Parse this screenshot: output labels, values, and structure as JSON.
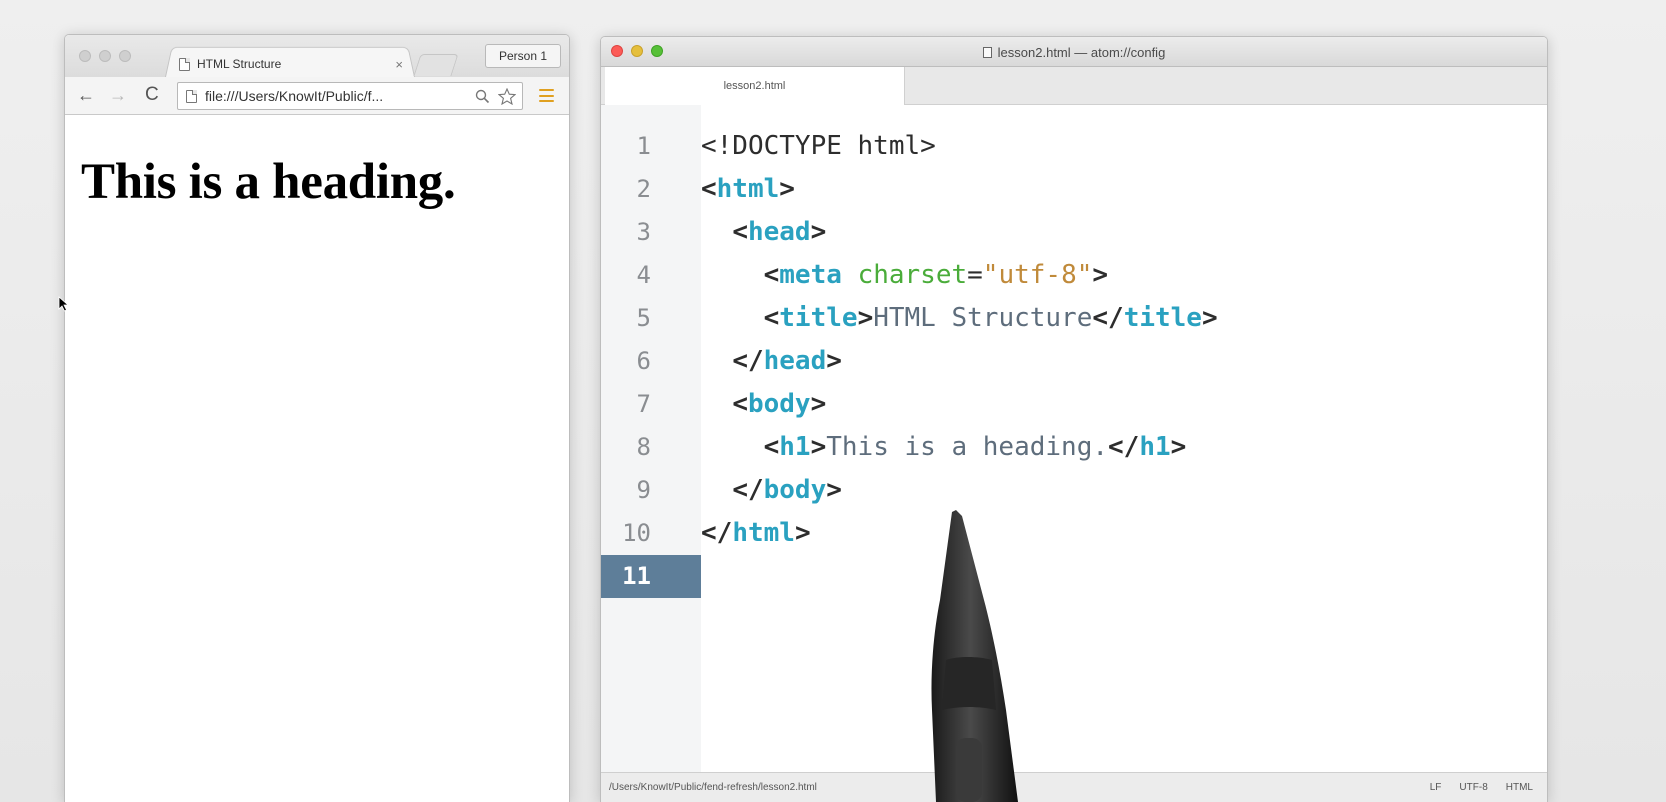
{
  "browser": {
    "tab_title": "HTML Structure",
    "tab_close": "×",
    "profile_button": "Person 1",
    "back": "←",
    "forward": "→",
    "reload": "C",
    "url": "file:///Users/KnowIt/Public/f...",
    "heading": "This is a heading."
  },
  "editor": {
    "window_title": "lesson2.html — atom://config",
    "tab_label": "lesson2.html",
    "line_numbers": [
      "1",
      "2",
      "3",
      "4",
      "5",
      "6",
      "7",
      "8",
      "9",
      "10",
      "11"
    ],
    "active_line": "11",
    "code": {
      "l1": "<!DOCTYPE html>",
      "tag_html": "html",
      "tag_head": "head",
      "tag_meta": "meta",
      "attr_charset": "charset",
      "val_charset": "\"utf-8\"",
      "tag_title": "title",
      "text_title": "HTML Structure",
      "tag_body": "body",
      "tag_h1": "h1",
      "text_h1": "This is a heading."
    },
    "status": {
      "path": "/Users/KnowIt/Public/fend-refresh/lesson2.html",
      "line_ending": "LF",
      "encoding": "UTF-8",
      "grammar": "HTML"
    }
  },
  "colors": {
    "tag": "#2aa1c0",
    "attribute": "#4aac3a",
    "string": "#c08a3a",
    "text": "#5e6d7c",
    "active_line_gutter": "#5e7e99"
  }
}
